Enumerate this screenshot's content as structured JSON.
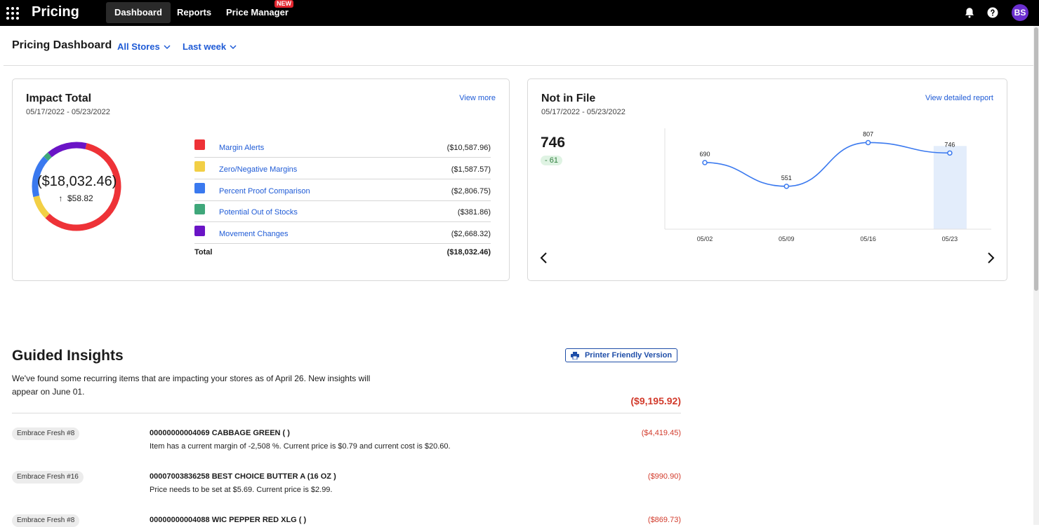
{
  "app": {
    "brand": "Pricing"
  },
  "nav": {
    "tabs": [
      {
        "label": "Dashboard"
      },
      {
        "label": "Reports"
      },
      {
        "label": "Price Manager"
      }
    ],
    "new_badge": "NEW"
  },
  "user": {
    "initials": "BS"
  },
  "header": {
    "title": "Pricing Dashboard",
    "store_filter": "All Stores",
    "date_filter": "Last week"
  },
  "impact": {
    "title": "Impact Total",
    "date_range": "05/17/2022 - 05/23/2022",
    "link": "View more",
    "total": "($18,032.46)",
    "delta": "$58.82",
    "items": [
      {
        "name": "Margin Alerts",
        "value": "($10,587.96)",
        "color": "#ee3237"
      },
      {
        "name": "Zero/Negative Margins",
        "value": "($1,587.57)",
        "color": "#f2cf45"
      },
      {
        "name": "Percent Proof Comparison",
        "value": "($2,806.75)",
        "color": "#3a79ef"
      },
      {
        "name": "Potential Out of Stocks",
        "value": "($381.86)",
        "color": "#3fa77a"
      },
      {
        "name": "Movement Changes",
        "value": "($2,668.32)",
        "color": "#6a14c6"
      }
    ],
    "total_label": "Total",
    "total_value": "($18,032.46)"
  },
  "not_in_file": {
    "title": "Not in File",
    "date_range": "05/17/2022 - 05/23/2022",
    "link": "View detailed report",
    "count": "746",
    "delta": "- 61"
  },
  "chart_data": {
    "type": "line",
    "categories": [
      "05/02",
      "05/09",
      "05/16",
      "05/23"
    ],
    "values": [
      690,
      551,
      807,
      746
    ],
    "ylim": [
      300,
      850
    ],
    "highlight_category": "05/23",
    "grid": false,
    "series_color": "#3a79ef"
  },
  "insights": {
    "title": "Guided Insights",
    "description": "We've found some recurring items that are impacting your stores as of April 26. New insights will appear on June 01.",
    "printer_label": "Printer Friendly Version",
    "total": "($9,195.92)",
    "items": [
      {
        "store": "Embrace Fresh #8",
        "title": "00000000004069 CABBAGE GREEN ( )",
        "desc": "Item has a current margin of -2,508 %. Current price is $0.79 and current cost is $20.60.",
        "amount": "($4,419.45)"
      },
      {
        "store": "Embrace Fresh #16",
        "title": "00007003836258 BEST CHOICE BUTTER A (16 OZ )",
        "desc": "Price needs to be set at $5.69. Current price is $2.99.",
        "amount": "($990.90)"
      },
      {
        "store": "Embrace Fresh #8",
        "title": "00000000004088 WIC PEPPER RED XLG ( )",
        "desc": "",
        "amount": "($869.73)"
      }
    ]
  }
}
